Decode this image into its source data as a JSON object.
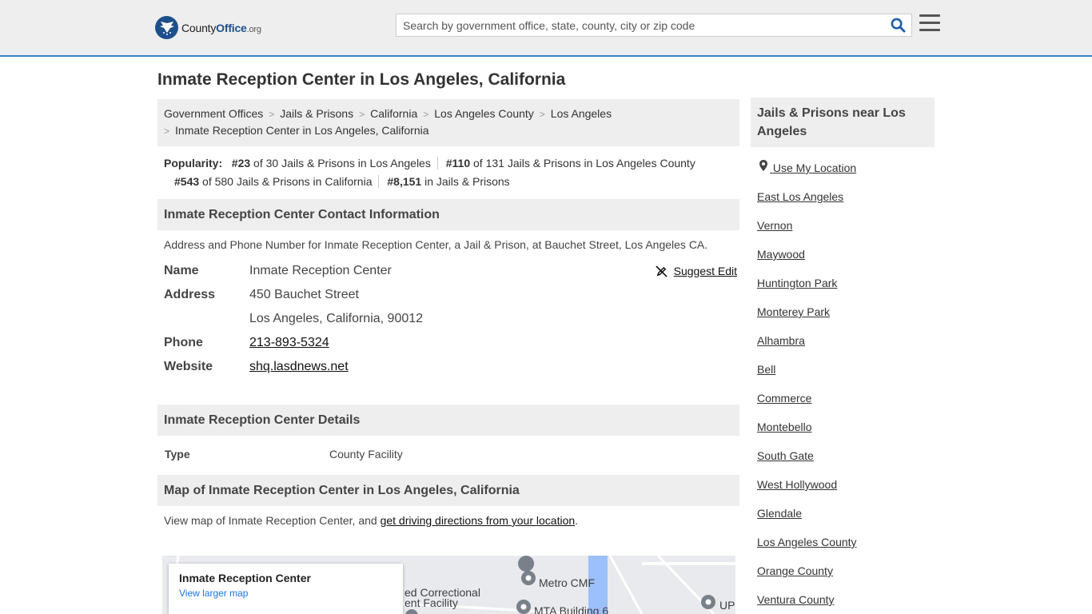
{
  "header": {
    "logo": {
      "brand_light": "County",
      "brand_bold": "Office",
      "tld": ".org"
    },
    "search": {
      "placeholder": "Search by government office, state, county, city or zip code"
    }
  },
  "page_title": "Inmate Reception Center in Los Angeles, California",
  "breadcrumb": {
    "items": [
      "Government Offices",
      "Jails & Prisons",
      "California",
      "Los Angeles County",
      "Los Angeles"
    ],
    "current": "Inmate Reception Center in Los Angeles, California"
  },
  "popularity": {
    "label": "Popularity:",
    "items": [
      {
        "rank": "#23",
        "text": " of 30 Jails & Prisons in Los Angeles"
      },
      {
        "rank": "#110",
        "text": " of 131 Jails & Prisons in Los Angeles County"
      },
      {
        "rank": "#543",
        "text": " of 580 Jails & Prisons in California"
      },
      {
        "rank": "#8,151",
        "text": " in Jails & Prisons"
      }
    ]
  },
  "contact": {
    "heading": "Inmate Reception Center Contact Information",
    "description": "Address and Phone Number for Inmate Reception Center, a Jail & Prison, at Bauchet Street, Los Angeles CA.",
    "suggest_edit": "Suggest Edit",
    "name_label": "Name",
    "name": "Inmate Reception Center",
    "address_label": "Address",
    "address_line1": "450 Bauchet Street",
    "address_line2": "Los Angeles, California, 90012",
    "phone_label": "Phone",
    "phone": "213-893-5324",
    "website_label": "Website",
    "website": "shq.lasdnews.net"
  },
  "details": {
    "heading": "Inmate Reception Center Details",
    "type_label": "Type",
    "type_value": "County Facility"
  },
  "map": {
    "heading": "Map of Inmate Reception Center in Los Angeles, California",
    "desc_prefix": "View map of Inmate Reception Center, and ",
    "desc_link": "get driving directions from your location",
    "desc_suffix": ".",
    "card_title": "Inmate Reception Center",
    "card_link": "View larger map",
    "labels": [
      "Metro CMF",
      "ed Correctional",
      "ent Facility",
      "MTA Building 6",
      "UP"
    ]
  },
  "sidebar": {
    "heading": "Jails & Prisons near Los Angeles",
    "use_location": "Use My Location",
    "links": [
      "East Los Angeles",
      "Vernon",
      "Maywood",
      "Huntington Park",
      "Monterey Park",
      "Alhambra",
      "Bell",
      "Commerce",
      "Montebello",
      "South Gate",
      "West Hollywood",
      "Glendale",
      "Los Angeles County",
      "Orange County",
      "Ventura County"
    ]
  },
  "colors": {
    "accent": "#3b82c4",
    "brand": "#1e4f8a",
    "panel": "#eeeeee",
    "search_icon": "#1e5fa8"
  }
}
